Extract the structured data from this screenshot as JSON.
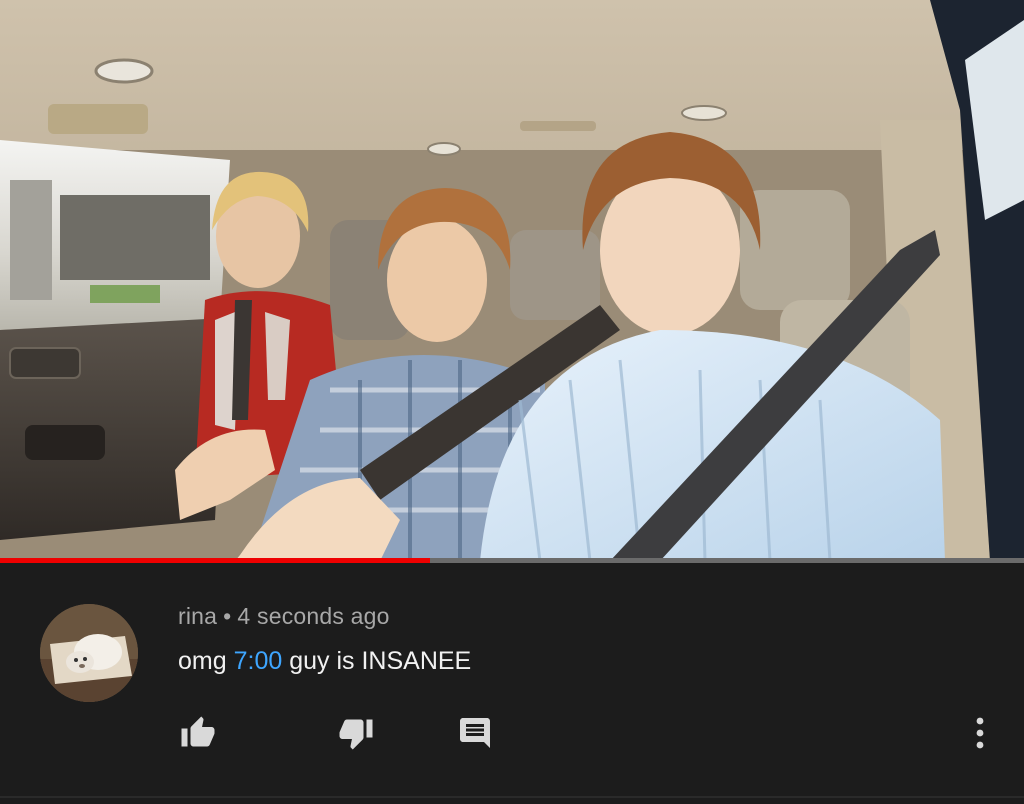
{
  "video": {
    "progress_fraction": 0.42
  },
  "comment": {
    "author": "rina",
    "separator": "•",
    "time_ago": "4 seconds ago",
    "text_before": "omg ",
    "timestamp": "7:00",
    "text_after": " guy is INSANEE",
    "actions": {
      "like_icon": "thumbs-up-icon",
      "dislike_icon": "thumbs-down-icon",
      "reply_icon": "comment-icon",
      "more_icon": "vertical-ellipsis-icon"
    }
  },
  "colors": {
    "background": "#1c1c1c",
    "progress": "#ee0000",
    "link": "#3ea6ff",
    "meta_text": "#a8a8a8",
    "body_text": "#f1f1f1",
    "icon": "#d9d9d9"
  }
}
